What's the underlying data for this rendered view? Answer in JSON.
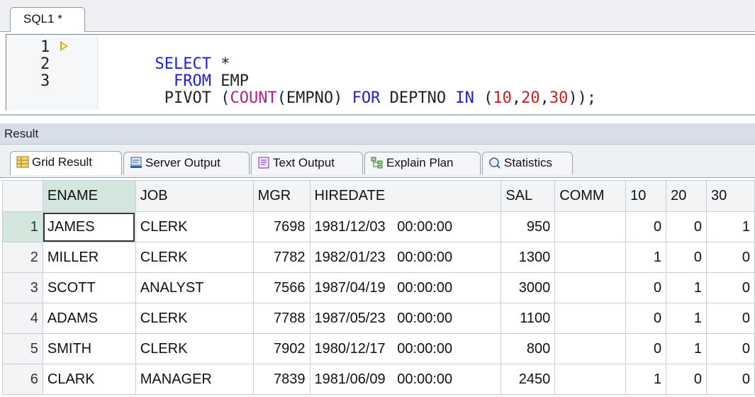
{
  "editor_tab": {
    "label": "SQL1 *"
  },
  "editor": {
    "line_numbers": [
      "1",
      "2",
      "3"
    ],
    "lines": [
      [
        {
          "t": "SELECT",
          "c": "kw"
        },
        {
          "t": " *",
          "c": ""
        }
      ],
      [
        {
          "t": "  FROM",
          "c": "kw"
        },
        {
          "t": " EMP",
          "c": ""
        }
      ],
      [
        {
          "t": " PIVOT (",
          "c": ""
        },
        {
          "t": "COUNT",
          "c": "fn"
        },
        {
          "t": "(EMPNO) ",
          "c": ""
        },
        {
          "t": "FOR",
          "c": "kw"
        },
        {
          "t": " DEPTNO ",
          "c": ""
        },
        {
          "t": "IN",
          "c": "kw"
        },
        {
          "t": " (",
          "c": ""
        },
        {
          "t": "10",
          "c": "num"
        },
        {
          "t": ",",
          "c": ""
        },
        {
          "t": "20",
          "c": "num"
        },
        {
          "t": ",",
          "c": ""
        },
        {
          "t": "30",
          "c": "num"
        },
        {
          "t": "));",
          "c": ""
        }
      ]
    ]
  },
  "result": {
    "header": "Result",
    "tabs": [
      {
        "label": "Grid Result",
        "icon": "grid-icon",
        "active": true
      },
      {
        "label": "Server Output",
        "icon": "server-output-icon",
        "active": false
      },
      {
        "label": "Text Output",
        "icon": "text-output-icon",
        "active": false
      },
      {
        "label": "Explain Plan",
        "icon": "explain-plan-icon",
        "active": false
      },
      {
        "label": "Statistics",
        "icon": "statistics-icon",
        "active": false
      }
    ]
  },
  "grid": {
    "columns": [
      "ENAME",
      "JOB",
      "MGR",
      "HIREDATE",
      "SAL",
      "COMM",
      "10",
      "20",
      "30"
    ],
    "rows": [
      {
        "n": "1",
        "cells": [
          "JAMES",
          "CLERK",
          "7698",
          "1981/12/03   00:00:00",
          "950",
          "",
          "0",
          "0",
          "1"
        ]
      },
      {
        "n": "2",
        "cells": [
          "MILLER",
          "CLERK",
          "7782",
          "1982/01/23   00:00:00",
          "1300",
          "",
          "1",
          "0",
          "0"
        ]
      },
      {
        "n": "3",
        "cells": [
          "SCOTT",
          "ANALYST",
          "7566",
          "1987/04/19   00:00:00",
          "3000",
          "",
          "0",
          "1",
          "0"
        ]
      },
      {
        "n": "4",
        "cells": [
          "ADAMS",
          "CLERK",
          "7788",
          "1987/05/23   00:00:00",
          "1100",
          "",
          "0",
          "1",
          "0"
        ]
      },
      {
        "n": "5",
        "cells": [
          "SMITH",
          "CLERK",
          "7902",
          "1980/12/17   00:00:00",
          "800",
          "",
          "0",
          "1",
          "0"
        ]
      },
      {
        "n": "6",
        "cells": [
          "CLARK",
          "MANAGER",
          "7839",
          "1981/06/09   00:00:00",
          "2450",
          "",
          "1",
          "0",
          "0"
        ]
      }
    ]
  }
}
